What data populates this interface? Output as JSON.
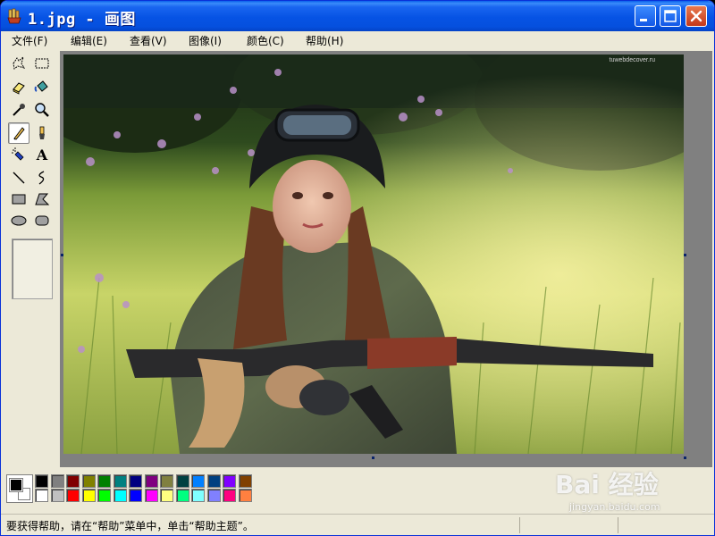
{
  "window": {
    "title": "1.jpg - 画图"
  },
  "menu": [
    {
      "label": "文件(F)"
    },
    {
      "label": "编辑(E)"
    },
    {
      "label": "查看(V)"
    },
    {
      "label": "图像(I)"
    },
    {
      "label": "颜色(C)"
    },
    {
      "label": "帮助(H)"
    }
  ],
  "tools": [
    {
      "name": "free-form-select-tool",
      "icon": "free-form-select-icon"
    },
    {
      "name": "rect-select-tool",
      "icon": "rect-select-icon"
    },
    {
      "name": "eraser-tool",
      "icon": "eraser-icon"
    },
    {
      "name": "fill-tool",
      "icon": "paint-bucket-icon"
    },
    {
      "name": "pick-color-tool",
      "icon": "eyedropper-icon"
    },
    {
      "name": "magnifier-tool",
      "icon": "magnifier-icon"
    },
    {
      "name": "pencil-tool",
      "icon": "pencil-icon",
      "selected": true
    },
    {
      "name": "brush-tool",
      "icon": "brush-icon"
    },
    {
      "name": "airbrush-tool",
      "icon": "airbrush-icon"
    },
    {
      "name": "text-tool",
      "icon": "text-icon",
      "glyph": "A"
    },
    {
      "name": "line-tool",
      "icon": "line-icon"
    },
    {
      "name": "curve-tool",
      "icon": "curve-icon"
    },
    {
      "name": "rectangle-tool",
      "icon": "rectangle-icon"
    },
    {
      "name": "polygon-tool",
      "icon": "polygon-icon"
    },
    {
      "name": "ellipse-tool",
      "icon": "ellipse-icon"
    },
    {
      "name": "rounded-rect-tool",
      "icon": "rounded-rectangle-icon"
    }
  ],
  "canvas": {
    "watermark_small": "tuwebdecover.ru"
  },
  "colors": {
    "foreground": "#000000",
    "background": "#FFFFFF",
    "palette_row1": [
      "#000000",
      "#808080",
      "#800000",
      "#808000",
      "#008000",
      "#008080",
      "#000080",
      "#800080",
      "#808040",
      "#004040",
      "#0080FF",
      "#004080",
      "#8000FF",
      "#804000"
    ],
    "palette_row2": [
      "#FFFFFF",
      "#C0C0C0",
      "#FF0000",
      "#FFFF00",
      "#00FF00",
      "#00FFFF",
      "#0000FF",
      "#FF00FF",
      "#FFFF80",
      "#00FF80",
      "#80FFFF",
      "#8080FF",
      "#FF0080",
      "#FF8040"
    ]
  },
  "status": {
    "text": "要获得帮助，请在“帮助”菜单中，单击“帮助主题”。"
  },
  "watermark": {
    "brand": "Bai 经验",
    "url": "jingyan.baidu.com"
  }
}
